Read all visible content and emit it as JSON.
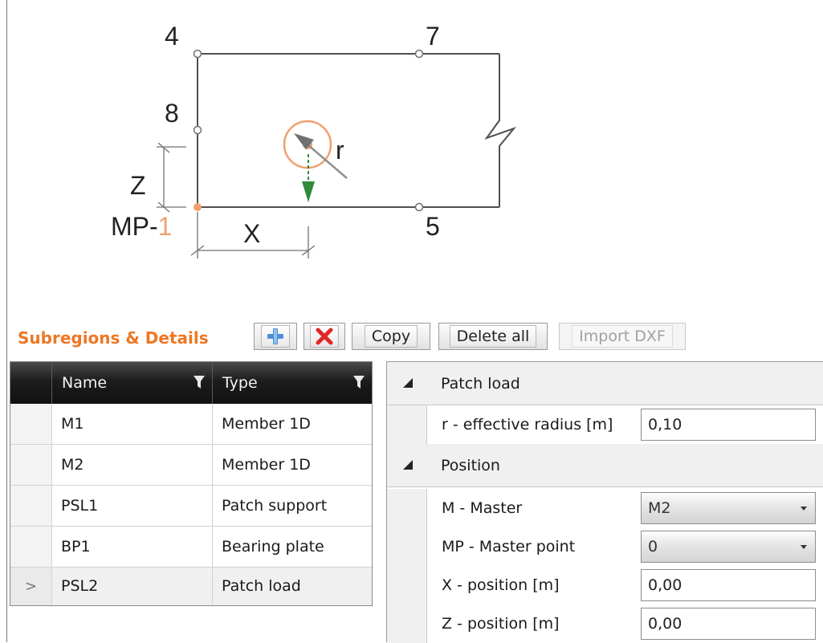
{
  "diagram": {
    "labels": {
      "n4": "4",
      "n7": "7",
      "n8": "8",
      "n5": "5",
      "z": "Z",
      "x": "X",
      "r": "r",
      "mp_prefix": "MP-",
      "mp_num": "1"
    },
    "colors": {
      "accent": "#f0a070",
      "arrow": "#2e8b3a",
      "line": "#505050"
    }
  },
  "toolbar": {
    "title": "Subregions & Details",
    "add_icon": "plus-icon",
    "delete_icon": "red-x-icon",
    "copy_label": "Copy",
    "delete_all_label": "Delete all",
    "import_label": "Import DXF"
  },
  "grid": {
    "columns": [
      "Name",
      "Type"
    ],
    "rows": [
      {
        "name": "M1",
        "type": "Member 1D"
      },
      {
        "name": "M2",
        "type": "Member 1D"
      },
      {
        "name": "PSL1",
        "type": "Patch support"
      },
      {
        "name": "BP1",
        "type": "Bearing plate"
      },
      {
        "name": "PSL2",
        "type": "Patch load"
      }
    ],
    "active_marker": ">"
  },
  "properties": {
    "cat1": "Patch load",
    "r_label": "r - effective radius [m]",
    "r_value": "0,10",
    "cat2": "Position",
    "m_label": "M - Master",
    "m_value": "M2",
    "mp_label": "MP - Master point",
    "mp_value": "0",
    "x_label": "X - position [m]",
    "x_value": "0,00",
    "z_label": "Z - position [m]",
    "z_value": "0,00"
  }
}
